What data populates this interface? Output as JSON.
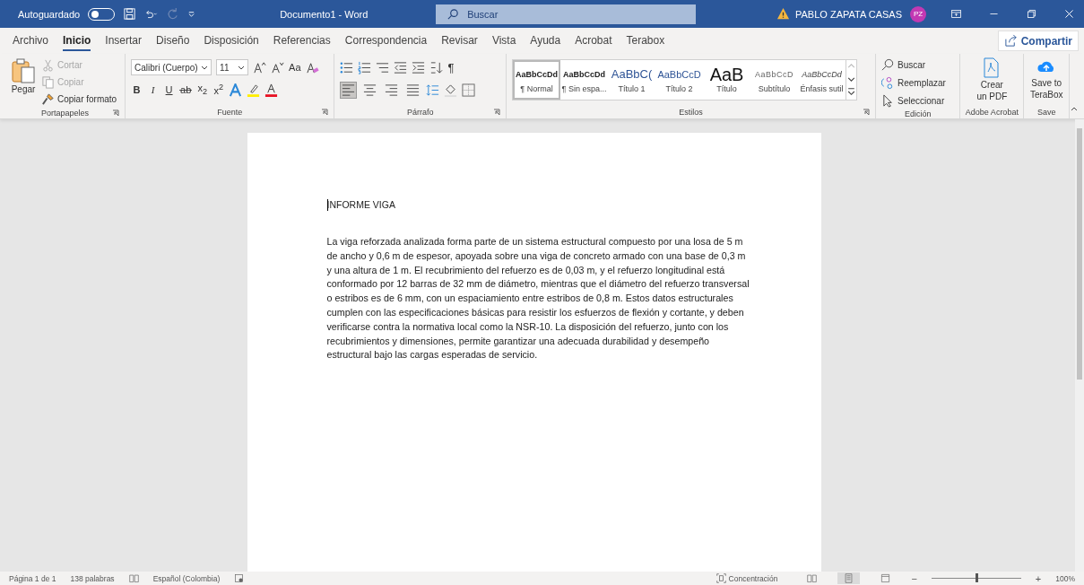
{
  "title_bar": {
    "autosave_label": "Autoguardado",
    "autosave_on": false,
    "document_title": "Documento1  -  Word",
    "search_placeholder": "Buscar",
    "user_name": "PABLO ZAPATA CASAS",
    "user_initials": "PZ"
  },
  "menu_tabs": [
    {
      "label": "Archivo",
      "selected": false
    },
    {
      "label": "Inicio",
      "selected": true
    },
    {
      "label": "Insertar",
      "selected": false
    },
    {
      "label": "Diseño",
      "selected": false
    },
    {
      "label": "Disposición",
      "selected": false
    },
    {
      "label": "Referencias",
      "selected": false
    },
    {
      "label": "Correspondencia",
      "selected": false
    },
    {
      "label": "Revisar",
      "selected": false
    },
    {
      "label": "Vista",
      "selected": false
    },
    {
      "label": "Ayuda",
      "selected": false
    },
    {
      "label": "Acrobat",
      "selected": false
    },
    {
      "label": "Terabox",
      "selected": false
    }
  ],
  "share_button": "Compartir",
  "ribbon": {
    "clipboard": {
      "paste": "Pegar",
      "items": [
        {
          "label": "Cortar",
          "kind": "cut",
          "disabled": true
        },
        {
          "label": "Copiar",
          "kind": "copy",
          "disabled": true
        },
        {
          "label": "Copiar formato",
          "kind": "painter",
          "disabled": false
        }
      ],
      "label": "Portapapeles"
    },
    "font": {
      "font_name": "Calibri (Cuerpo)",
      "font_size": "11",
      "change_case": "Aa",
      "format_keys": [
        {
          "label": "B",
          "kind": "bold"
        },
        {
          "label": "I",
          "kind": "italic"
        },
        {
          "label": "U",
          "kind": "underline"
        },
        {
          "label": "ab",
          "kind": "strike"
        },
        {
          "label": "x$_{2}$",
          "kind": "sub"
        },
        {
          "label": "x$^{2}$",
          "kind": "sup"
        }
      ],
      "label": "Fuente"
    },
    "paragraph": {
      "alignments": [
        {
          "kind": "left",
          "selected": true
        },
        {
          "kind": "center",
          "selected": false
        },
        {
          "kind": "right",
          "selected": false
        },
        {
          "kind": "justify",
          "selected": false
        }
      ],
      "marks": "¶",
      "label": "Párrafo"
    },
    "styles": {
      "items": [
        {
          "preview": "AaBbCcDd",
          "name": "¶ Normal",
          "kind": "normal",
          "selected": true
        },
        {
          "preview": "AaBbCcDd",
          "name": "¶ Sin espa...",
          "kind": "nospacing",
          "selected": false
        },
        {
          "preview": "AaBbC(",
          "name": "Título 1",
          "kind": "heading1",
          "selected": false
        },
        {
          "preview": "AaBbCcD",
          "name": "Título 2",
          "kind": "heading2",
          "selected": false
        },
        {
          "preview": "AaB",
          "name": "Título",
          "kind": "title",
          "selected": false
        },
        {
          "preview": "AaBbCcD",
          "name": "Subtítulo",
          "kind": "subtitle",
          "selected": false
        },
        {
          "preview": "AaBbCcDd",
          "name": "Énfasis sutil",
          "kind": "emphasis",
          "selected": false
        }
      ],
      "label": "Estilos"
    },
    "editing": {
      "items": [
        {
          "label": "Buscar",
          "kind": "find"
        },
        {
          "label": "Reemplazar",
          "kind": "replace"
        },
        {
          "label": "Seleccionar",
          "kind": "select"
        }
      ],
      "label": "Edición"
    },
    "acrobat": {
      "button_lines": [
        "Crear",
        "un PDF"
      ],
      "label": "Adobe Acrobat"
    },
    "terabox": {
      "button_lines": [
        "Save to",
        "TeraBox"
      ],
      "label": "Save"
    }
  },
  "document": {
    "heading": "INFORME VIGA",
    "paragraph": "La viga reforzada analizada forma parte de un sistema estructural compuesto por una losa de 5 m de ancho y 0,6 m de espesor, apoyada sobre una viga de concreto armado con una base de 0,3 m y una altura de 1 m. El recubrimiento del refuerzo es de 0,03 m, y el refuerzo longitudinal está conformado por 12 barras de 32 mm de diámetro, mientras que el diámetro del refuerzo transversal o estribos es de 6 mm, con un espaciamiento entre estribos de 0,8 m. Estos datos estructurales cumplen con las especificaciones básicas para resistir los esfuerzos de flexión y cortante, y deben verificarse contra la normativa local como la NSR-10. La disposición del refuerzo, junto con los recubrimientos y dimensiones, permite garantizar una adecuada durabilidad y desempeño estructural bajo las cargas esperadas de servicio."
  },
  "status_bar": {
    "page": "Página 1 de 1",
    "words": "138 palabras",
    "language": "Español (Colombia)",
    "focus": "Concentración",
    "views": [
      {
        "kind": "read",
        "selected": false
      },
      {
        "kind": "print",
        "selected": true
      },
      {
        "kind": "web",
        "selected": false
      }
    ],
    "zoom_out": "−",
    "zoom": {
      "level": 0.5
    },
    "zoom_in": "+",
    "zoom_label": "100%"
  }
}
